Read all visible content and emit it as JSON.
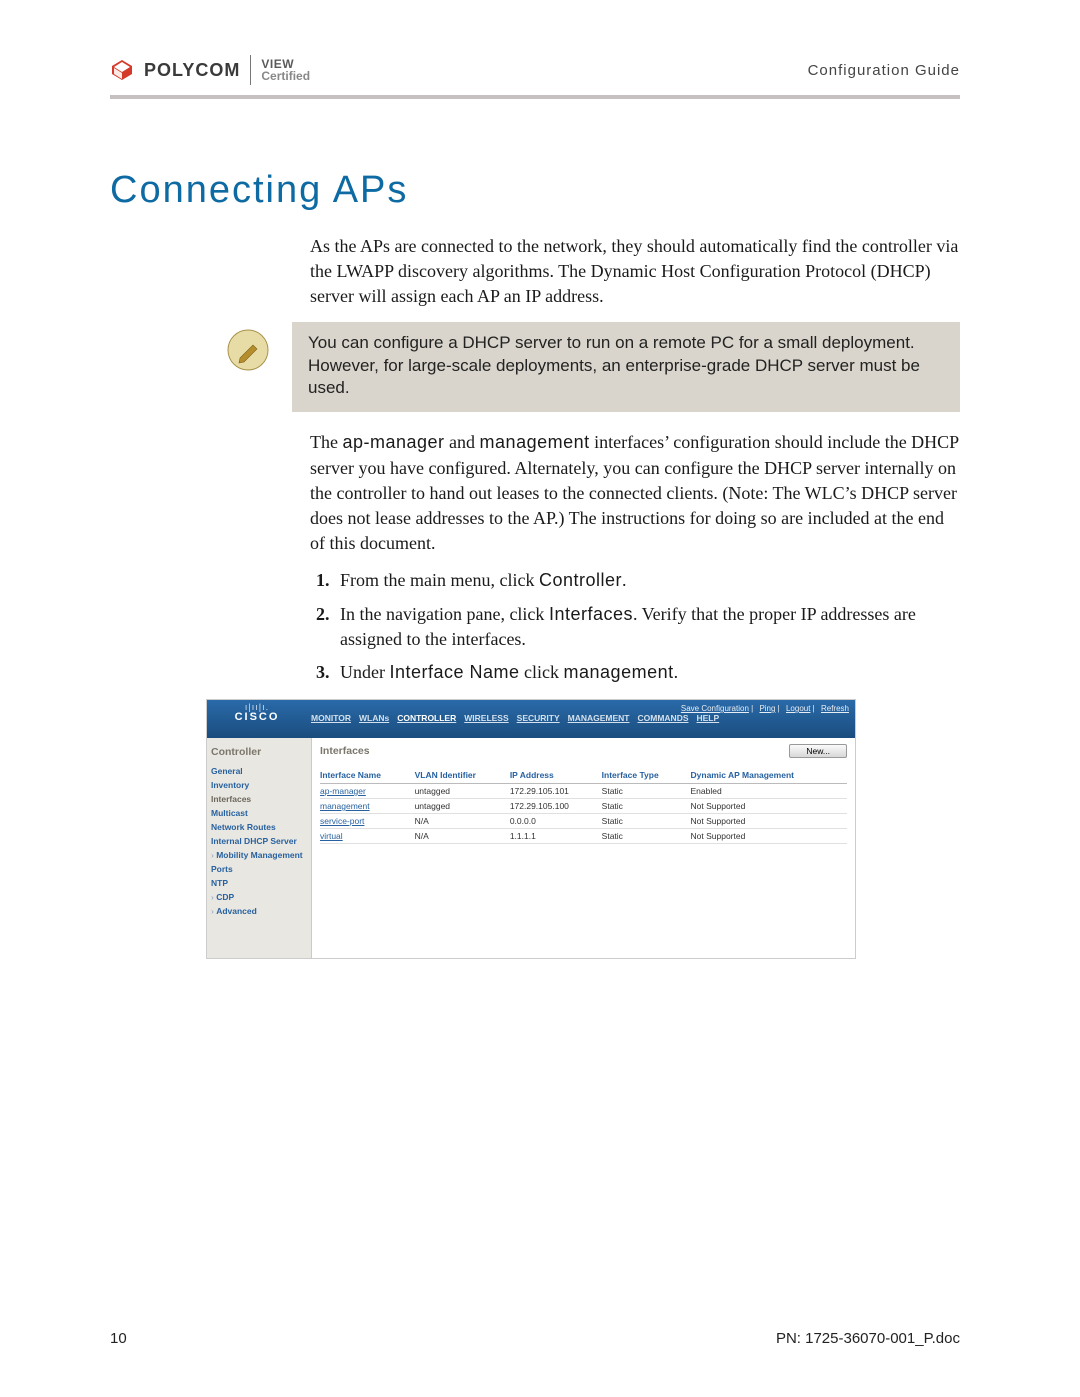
{
  "header": {
    "brand": "POLYCOM",
    "badge_line1": "VIEW",
    "badge_line2": "Certified",
    "right_label": "Configuration Guide"
  },
  "title": "Connecting APs",
  "para1": "As the APs are connected to the network, they should automatically find the controller via the LWAPP discovery algorithms. The Dynamic Host Configuration Protocol (DHCP) server will assign each AP an IP address.",
  "note": "You can configure a DHCP server to run on a remote PC for a small deployment. However, for large-scale deployments, an enterprise-grade DHCP server must be used.",
  "para2_pre": "The ",
  "para2_if1": "ap-manager",
  "para2_mid1": " and ",
  "para2_if2": "management",
  "para2_post": " interfaces’ configuration should include the DHCP server you have configured. Alternately, you can configure the DHCP server internally on the controller to hand out leases to the connected clients. (Note: The WLC’s DHCP server does not lease addresses to the AP.) The instructions for doing so are included at the end of this document.",
  "steps": {
    "s1_pre": "From the main menu, click ",
    "s1_t": "Controller",
    "s1_post": ".",
    "s2_pre": "In the navigation pane, click ",
    "s2_t": "Interfaces",
    "s2_post": ". Verify that the proper IP addresses are assigned to the interfaces.",
    "s3_pre": "Under ",
    "s3_t1": "Interface Name",
    "s3_mid": " click ",
    "s3_t2": "management",
    "s3_post": "."
  },
  "cisco": {
    "brand_bars": "ı|ıı|ı.",
    "brand_word": "CISCO",
    "util": [
      "Save Configuration",
      "Ping",
      "Logout",
      "Refresh"
    ],
    "tabs": [
      "MONITOR",
      "WLANs",
      "CONTROLLER",
      "WIRELESS",
      "SECURITY",
      "MANAGEMENT",
      "COMMANDS",
      "HELP"
    ],
    "side_title": "Controller",
    "side_items": [
      "General",
      "Inventory",
      "Interfaces",
      "Multicast",
      "Network Routes",
      "Internal DHCP Server",
      "Mobility Management",
      "Ports",
      "NTP",
      "CDP",
      "Advanced"
    ],
    "main_title": "Interfaces",
    "new_button": "New...",
    "columns": [
      "Interface Name",
      "VLAN Identifier",
      "IP Address",
      "Interface Type",
      "Dynamic AP Management"
    ],
    "rows": [
      {
        "name": "ap-manager",
        "vlan": "untagged",
        "ip": "172.29.105.101",
        "type": "Static",
        "dyn": "Enabled"
      },
      {
        "name": "management",
        "vlan": "untagged",
        "ip": "172.29.105.100",
        "type": "Static",
        "dyn": "Not Supported"
      },
      {
        "name": "service-port",
        "vlan": "N/A",
        "ip": "0.0.0.0",
        "type": "Static",
        "dyn": "Not Supported"
      },
      {
        "name": "virtual",
        "vlan": "N/A",
        "ip": "1.1.1.1",
        "type": "Static",
        "dyn": "Not Supported"
      }
    ]
  },
  "footer": {
    "page_number": "10",
    "doc_id": "PN: 1725-36070-001_P.doc"
  }
}
